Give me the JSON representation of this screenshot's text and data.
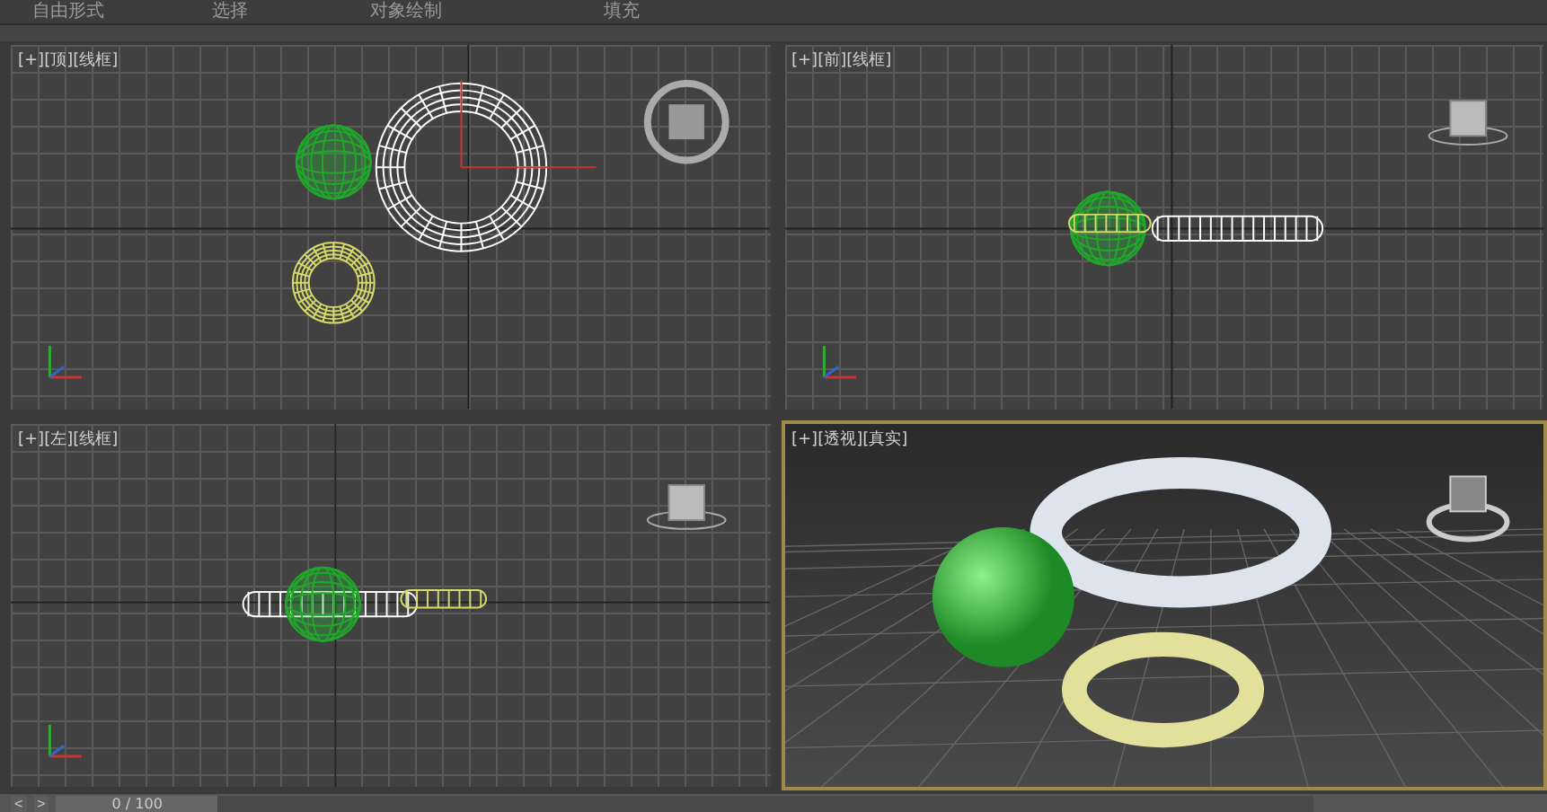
{
  "menu_bar": {
    "items": [
      "自由形式",
      "选择",
      "对象绘制",
      "填充"
    ]
  },
  "viewports": [
    {
      "kind": "top",
      "label": "[+][顶][线框]",
      "selected": false
    },
    {
      "kind": "front",
      "label": "[+][前][线框]",
      "selected": false
    },
    {
      "kind": "left",
      "label": "[+][左][线框]",
      "selected": false
    },
    {
      "kind": "perspective",
      "label": "[+][透视][真实]",
      "selected": true
    }
  ],
  "time_slider": {
    "frame": "0 / 100",
    "level": 0,
    "prev": "<",
    "next": ">"
  }
}
